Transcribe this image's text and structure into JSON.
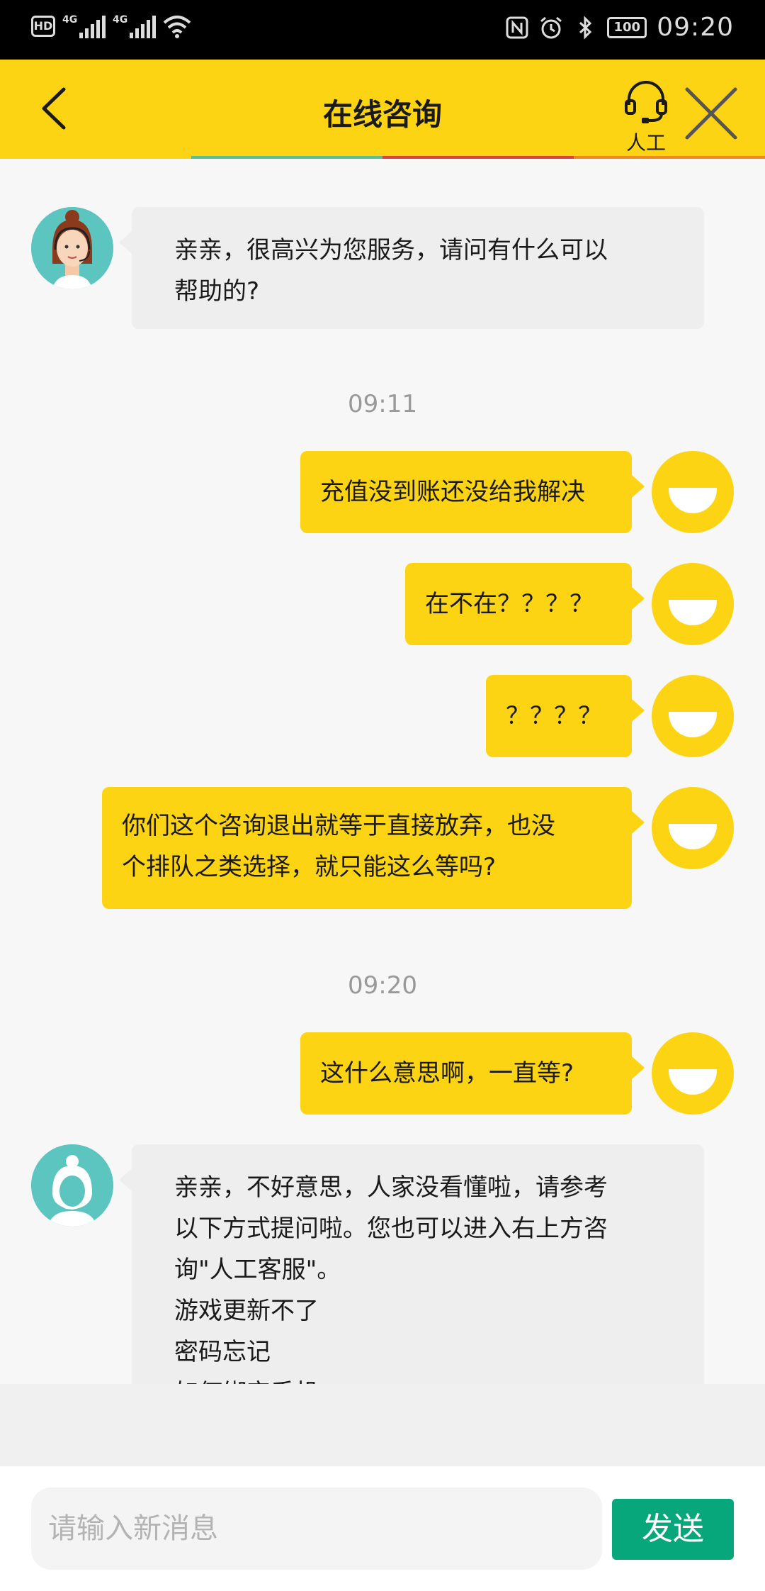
{
  "status_bar": {
    "hd_label": "HD",
    "net1": "4G",
    "net2": "4G",
    "battery": "100",
    "time": "09:20"
  },
  "header": {
    "title": "在线咨询",
    "agent_label": "人工"
  },
  "progress_colors": [
    "#fdd413",
    "#5bc08e",
    "#d8453b",
    "#f08a1d"
  ],
  "chat": {
    "messages": [
      {
        "side": "agent",
        "lines": [
          "亲亲，很高兴为您服务，请问有什么可以",
          "帮助的?"
        ]
      },
      {
        "type": "timestamp",
        "text": "09:11"
      },
      {
        "side": "user",
        "lines": [
          "充值没到账还没给我解决"
        ]
      },
      {
        "side": "user",
        "lines": [
          "在不在？？？？"
        ]
      },
      {
        "side": "user",
        "lines": [
          "？？？？"
        ]
      },
      {
        "side": "user",
        "lines": [
          "你们这个咨询退出就等于直接放弃，也没",
          "个排队之类选择，就只能这么等吗?"
        ]
      },
      {
        "type": "timestamp",
        "text": "09:20"
      },
      {
        "side": "user",
        "lines": [
          "这什么意思啊，一直等?"
        ]
      },
      {
        "side": "agent",
        "lines": [
          "亲亲，不好意思，人家没看懂啦，请参考",
          "以下方式提问啦。您也可以进入右上方咨",
          "询\"人工客服\"。",
          "游戏更新不了",
          "密码忘记",
          "如何绑定手机"
        ]
      }
    ]
  },
  "input": {
    "placeholder": "请输入新消息",
    "send_label": "发送"
  }
}
